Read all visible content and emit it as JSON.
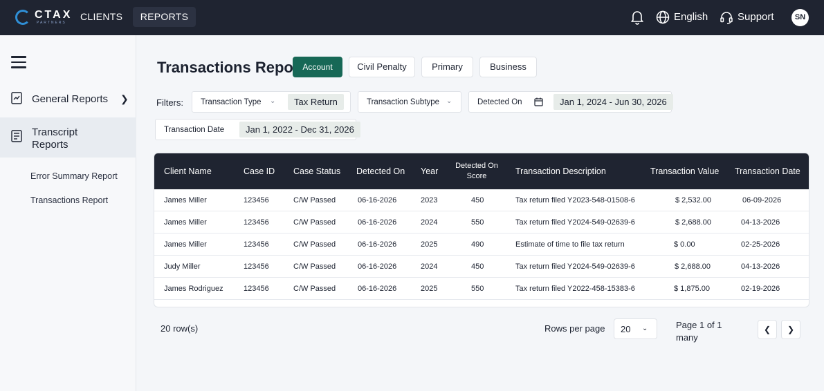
{
  "topbar": {
    "logo_text": "CTAX",
    "logo_sub": "PARTNERS",
    "nav_clients": "CLIENTS",
    "nav_reports": "REPORTS",
    "language": "English",
    "support": "Support",
    "avatar_initials": "SN"
  },
  "sidebar": {
    "general_reports": "General Reports",
    "transcript_reports": "Transcript Reports",
    "sub_items": [
      "Error Summary Report",
      "Transactions Report"
    ]
  },
  "header": {
    "title": "Transactions Report",
    "tabs": [
      "Account",
      "Civil Penalty",
      "Primary",
      "Business"
    ]
  },
  "filters": {
    "label": "Filters:",
    "transaction_type": "Transaction Type",
    "transaction_type_value": "Tax Return",
    "transaction_subtype": "Transaction Subtype",
    "detected_on": "Detected On",
    "detected_on_range": "Jan 1, 2024 - Jun 30, 2026",
    "transaction_date": "Transaction Date",
    "transaction_date_range": "Jan 1, 2022 - Dec 31, 2026"
  },
  "table": {
    "columns": [
      "Client Name",
      "Case ID",
      "Case Status",
      "Detected On",
      "Year",
      "Detected On Score",
      "Transaction Description",
      "Transaction Value",
      "Transaction Date"
    ],
    "column_score_line1": "Detected On",
    "column_score_line2": "Score",
    "rows": [
      [
        "James Miller",
        "123456",
        "C/W Passed",
        "06-16-2026",
        "2023",
        "450",
        "Tax return filed Y2023-548-01508-6",
        "$ 2,532.00",
        "06-09-2026"
      ],
      [
        "James Miller",
        "123456",
        "C/W Passed",
        "06-16-2026",
        "2024",
        "550",
        "Tax return filed Y2024-549-02639-6",
        "$ 2,688.00",
        "04-13-2026"
      ],
      [
        "James Miller",
        "123456",
        "C/W Passed",
        "06-16-2026",
        "2025",
        "490",
        "Estimate of time to file tax return",
        "$ 0.00",
        "02-25-2026"
      ],
      [
        "Judy Miller",
        "123456",
        "C/W Passed",
        "06-16-2026",
        "2024",
        "450",
        "Tax return filed Y2024-549-02639-6",
        "$ 2,688.00",
        "04-13-2026"
      ],
      [
        "James Rodriguez",
        "123456",
        "C/W Passed",
        "06-16-2026",
        "2025",
        "550",
        "Tax return filed Y2022-458-15383-6",
        "$ 1,875.00",
        "02-19-2026"
      ]
    ]
  },
  "footer": {
    "row_count": "20 row(s)",
    "rows_per_page_label": "Rows per page",
    "rows_per_page_value": "20",
    "page_info": "Page 1 of 1 many"
  },
  "colors": {
    "topbar": "#1f2431",
    "accent": "#176856",
    "logo_ring": "#2f8fd6"
  },
  "icons": [
    "bell-icon",
    "globe-icon",
    "headset-icon",
    "menu-icon",
    "report-icon",
    "calendar-icon",
    "chevron-down-icon",
    "chevron-left-icon",
    "chevron-right-icon"
  ]
}
